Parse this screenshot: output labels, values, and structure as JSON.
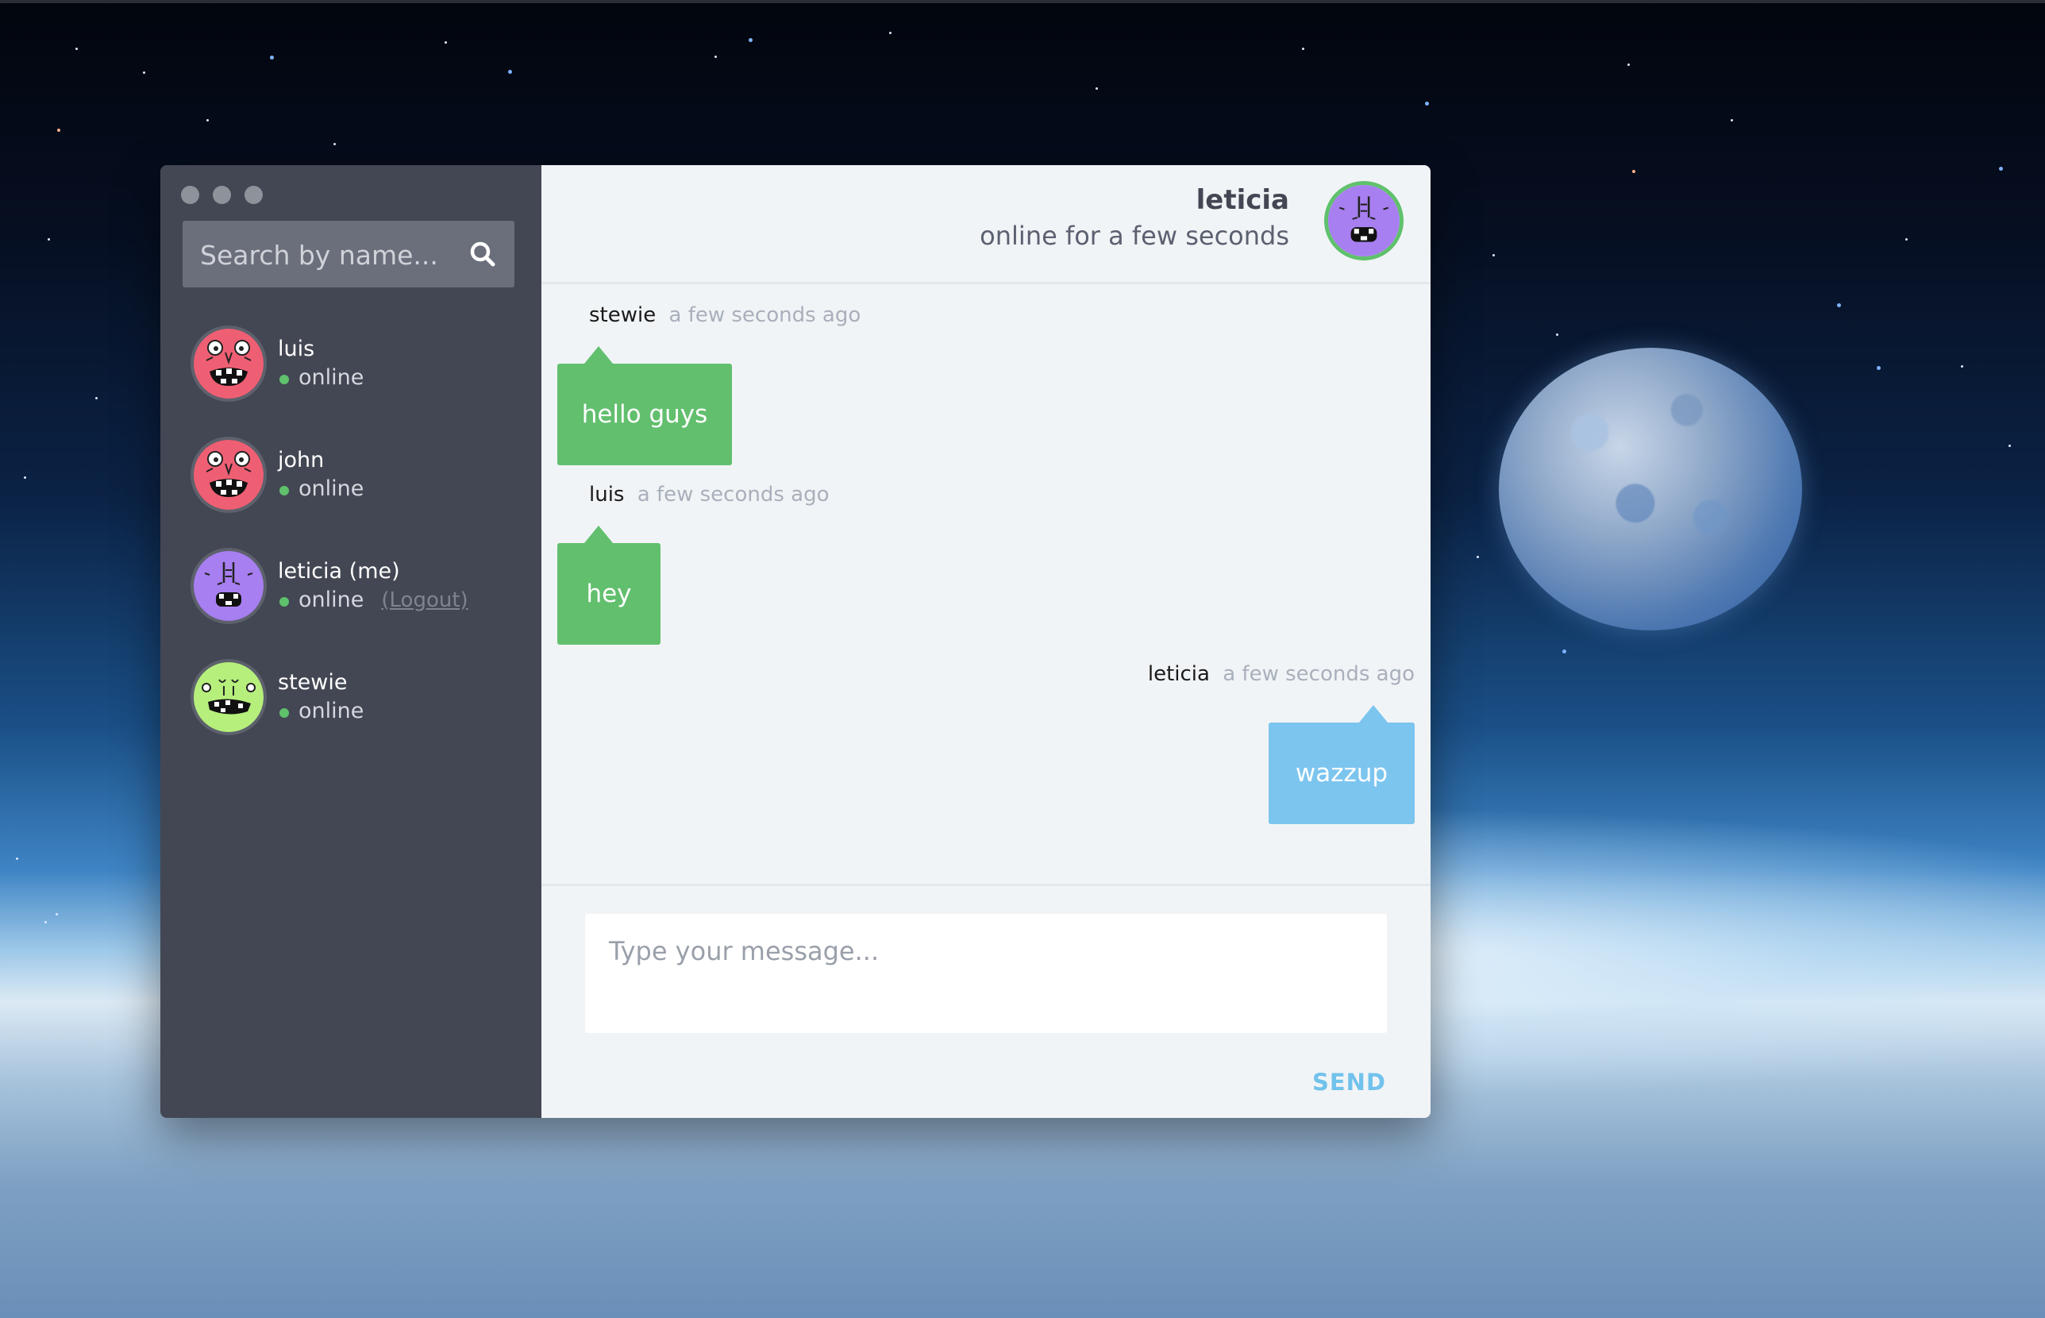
{
  "sidebar": {
    "search": {
      "placeholder": "Search by name..."
    },
    "users": [
      {
        "name": "luis",
        "status": "online",
        "avatar": "pink-monster-avatar"
      },
      {
        "name": "john",
        "status": "online",
        "avatar": "pink-monster-avatar"
      },
      {
        "name": "leticia (me)",
        "status": "online",
        "logout_label": "(Logout)",
        "avatar": "purple-monster-avatar"
      },
      {
        "name": "stewie",
        "status": "online",
        "avatar": "green-monster-avatar"
      }
    ]
  },
  "chat": {
    "header": {
      "name": "leticia",
      "status": "online for a few seconds",
      "avatar": "purple-monster-avatar"
    },
    "messages": [
      {
        "author": "stewie",
        "time": "a few seconds ago",
        "text": "hello guys",
        "side": "left",
        "color": "#62bf6e"
      },
      {
        "author": "luis",
        "time": "a few seconds ago",
        "text": "hey",
        "side": "left",
        "color": "#62bf6e"
      },
      {
        "author": "leticia",
        "time": "a few seconds ago",
        "text": "wazzup",
        "side": "right",
        "color": "#7cc5ef"
      }
    ],
    "composer": {
      "placeholder": "Type your message...",
      "send_label": "SEND"
    }
  },
  "colors": {
    "sidebar_bg": "#434753",
    "chat_bg": "#f1f4f6",
    "online_green": "#5fc16c",
    "send_blue": "#71c2ec"
  }
}
